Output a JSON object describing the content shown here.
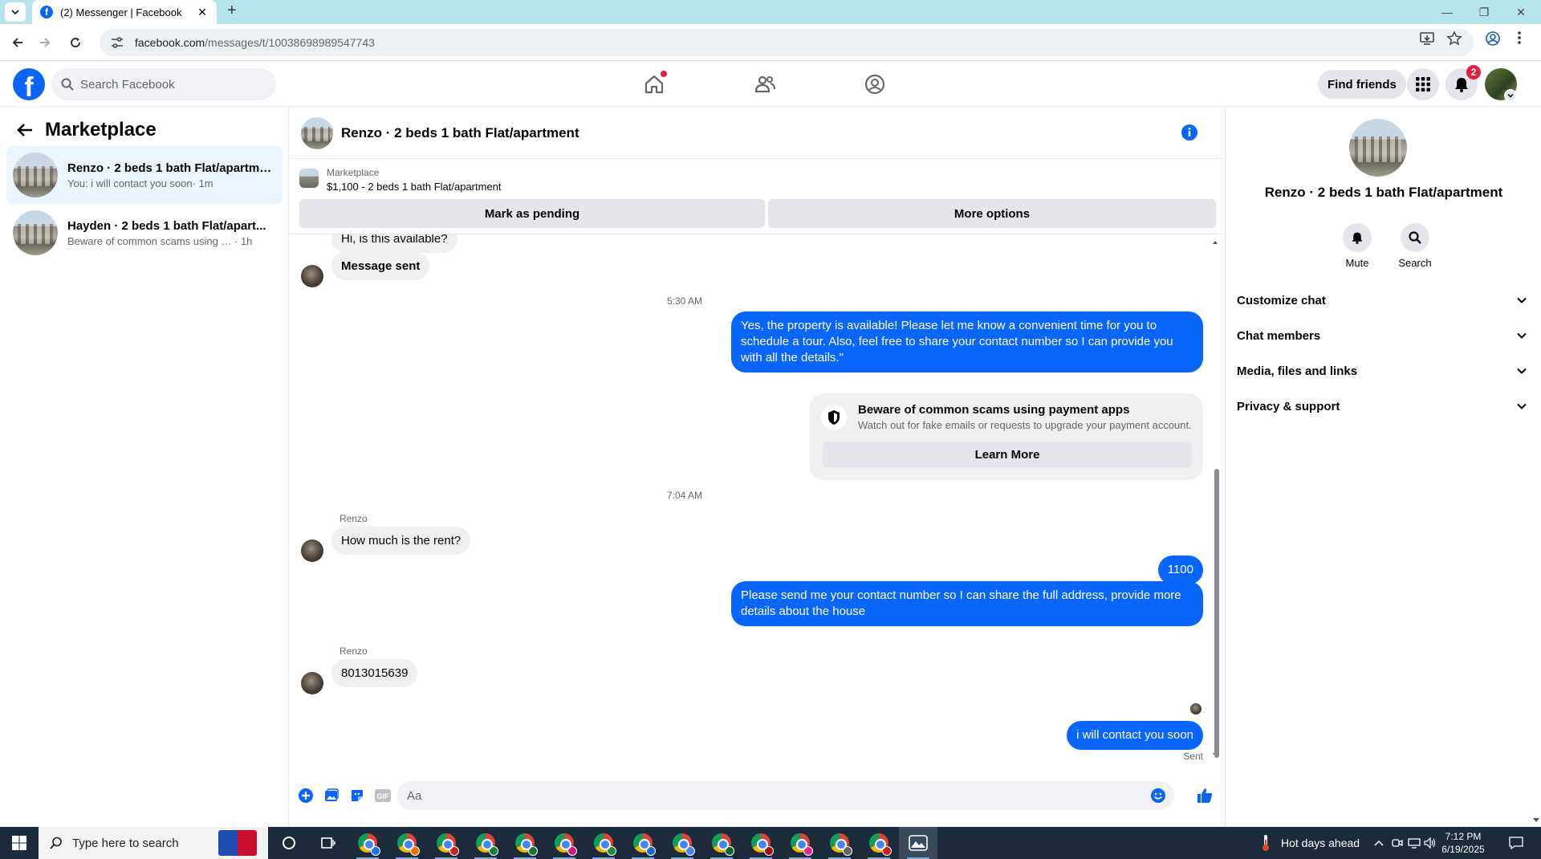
{
  "browser": {
    "tab_title": "(2) Messenger | Facebook",
    "url_host": "facebook.com",
    "url_path": "/messages/t/10038698989547743"
  },
  "fb": {
    "logo_letter": "f",
    "search_placeholder": "Search Facebook",
    "find_friends": "Find friends",
    "notification_count": "2"
  },
  "sidebar": {
    "title": "Marketplace",
    "conversations": [
      {
        "name": "Renzo · 2 beds 1 bath Flat/apartme...",
        "snippet": "You: i will contact you soon",
        "time": " · 1m",
        "active": true
      },
      {
        "name": "Hayden · 2 beds 1 bath Flat/apart...",
        "snippet": "Beware of common scams using pay...",
        "time": " · 1h",
        "active": false
      }
    ]
  },
  "chat": {
    "title": "Renzo · 2 beds 1 bath Flat/apartment",
    "listing_label": "Marketplace",
    "listing_price": "$1,100 - 2 beds 1 bath Flat/apartment",
    "mark_pending": "Mark as pending",
    "more_options": "More options",
    "messages": {
      "m1": "Hi, is this available?",
      "m2": "Message sent",
      "ts1": "5:30 AM",
      "m3_line1": "Yes, the property is available! Please let me know a convenient time for you to",
      "m3_line2": "schedule a tour. Also, feel free to share your contact number so I can provide you",
      "m3_line3": "with all the details.\"",
      "warn_title": "Beware of common scams using payment apps",
      "warn_desc": "Watch out for fake emails or requests to upgrade your payment account.",
      "learn_more": "Learn More",
      "ts2": "7:04 AM",
      "sender1": "Renzo",
      "m4": "How much is the rent?",
      "m5": "1100",
      "m6_line1": "Please send me your contact number so I can share the full address, provide more",
      "m6_line2": "details about the house",
      "sender2": "Renzo",
      "m7": "8013015639",
      "m8": "i will contact you soon",
      "sent": "Sent"
    },
    "composer_placeholder": "Aa"
  },
  "right_panel": {
    "name": "Renzo · 2 beds 1 bath Flat/apartment",
    "mute": "Mute",
    "search": "Search",
    "sections": [
      "Customize chat",
      "Chat members",
      "Media, files and links",
      "Privacy & support"
    ]
  },
  "taskbar": {
    "search_placeholder": "Type here to search",
    "weather": "Hot days ahead",
    "time": "7:12 PM",
    "date": "6/19/2025"
  }
}
